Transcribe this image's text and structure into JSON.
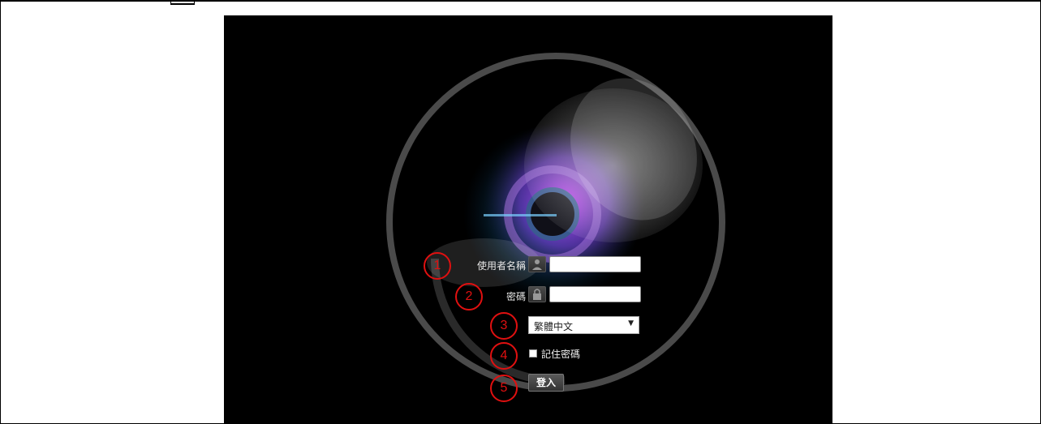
{
  "login": {
    "username_label": "使用者名稱",
    "password_label": "密碼",
    "language_value": "繁體中文",
    "remember_label": "記住密碼",
    "login_button": "登入"
  },
  "callouts": [
    "1",
    "2",
    "3",
    "4",
    "5"
  ],
  "icons": {
    "username": "user-icon",
    "password": "lock-icon",
    "dropdown": "chevron-down-icon"
  },
  "colors": {
    "callout": "#e01010",
    "panel_bg": "#000000"
  }
}
